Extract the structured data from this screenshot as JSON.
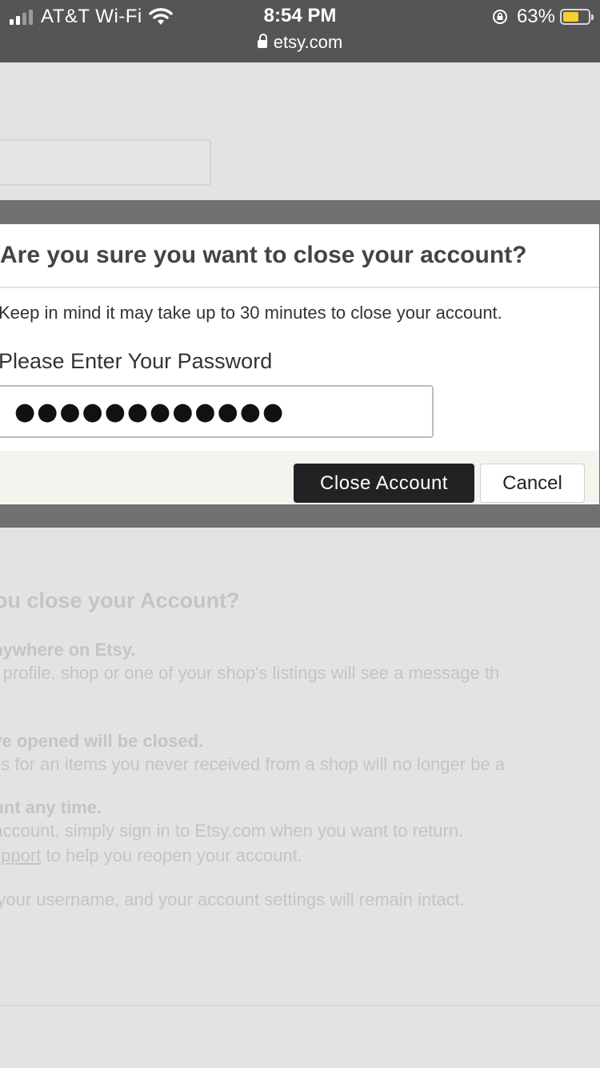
{
  "status_bar": {
    "carrier": "AT&T Wi-Fi",
    "time": "8:54 PM",
    "url": "etsy.com",
    "battery_percent": "63%",
    "battery_level": 0.63,
    "icons": [
      "signal-icon",
      "wifi-icon",
      "lock-icon",
      "rotation-lock-icon",
      "battery-icon"
    ],
    "battery_color": "#f5cf2f"
  },
  "modal": {
    "title": "Are you sure you want to close your account?",
    "note": "Keep in mind it may take up to 30 minutes to close your account.",
    "password_label": "Please Enter Your Password",
    "password_value": "●●●●●●●●●●●●",
    "close_button": "Close Account",
    "cancel_button": "Cancel",
    "close_button_color": "#222222"
  },
  "background": {
    "heading": "you close your Account?",
    "item1_title": " anywhere on Etsy.",
    "item1_text": "ur profile, shop or one of your shop's listings will see a message th",
    "item2_title": "ave opened will be closed.",
    "item2_text": "ses for an items you never received from a shop will no longer be a",
    "item3_title": "ount any time.",
    "item3_text": "r account, simply sign in to Etsy.com when you want to return.",
    "item3_link": " support",
    "item3_after_link": " to help you reopen your account.",
    "item4_text": "e your username, and your account settings will remain intact."
  }
}
